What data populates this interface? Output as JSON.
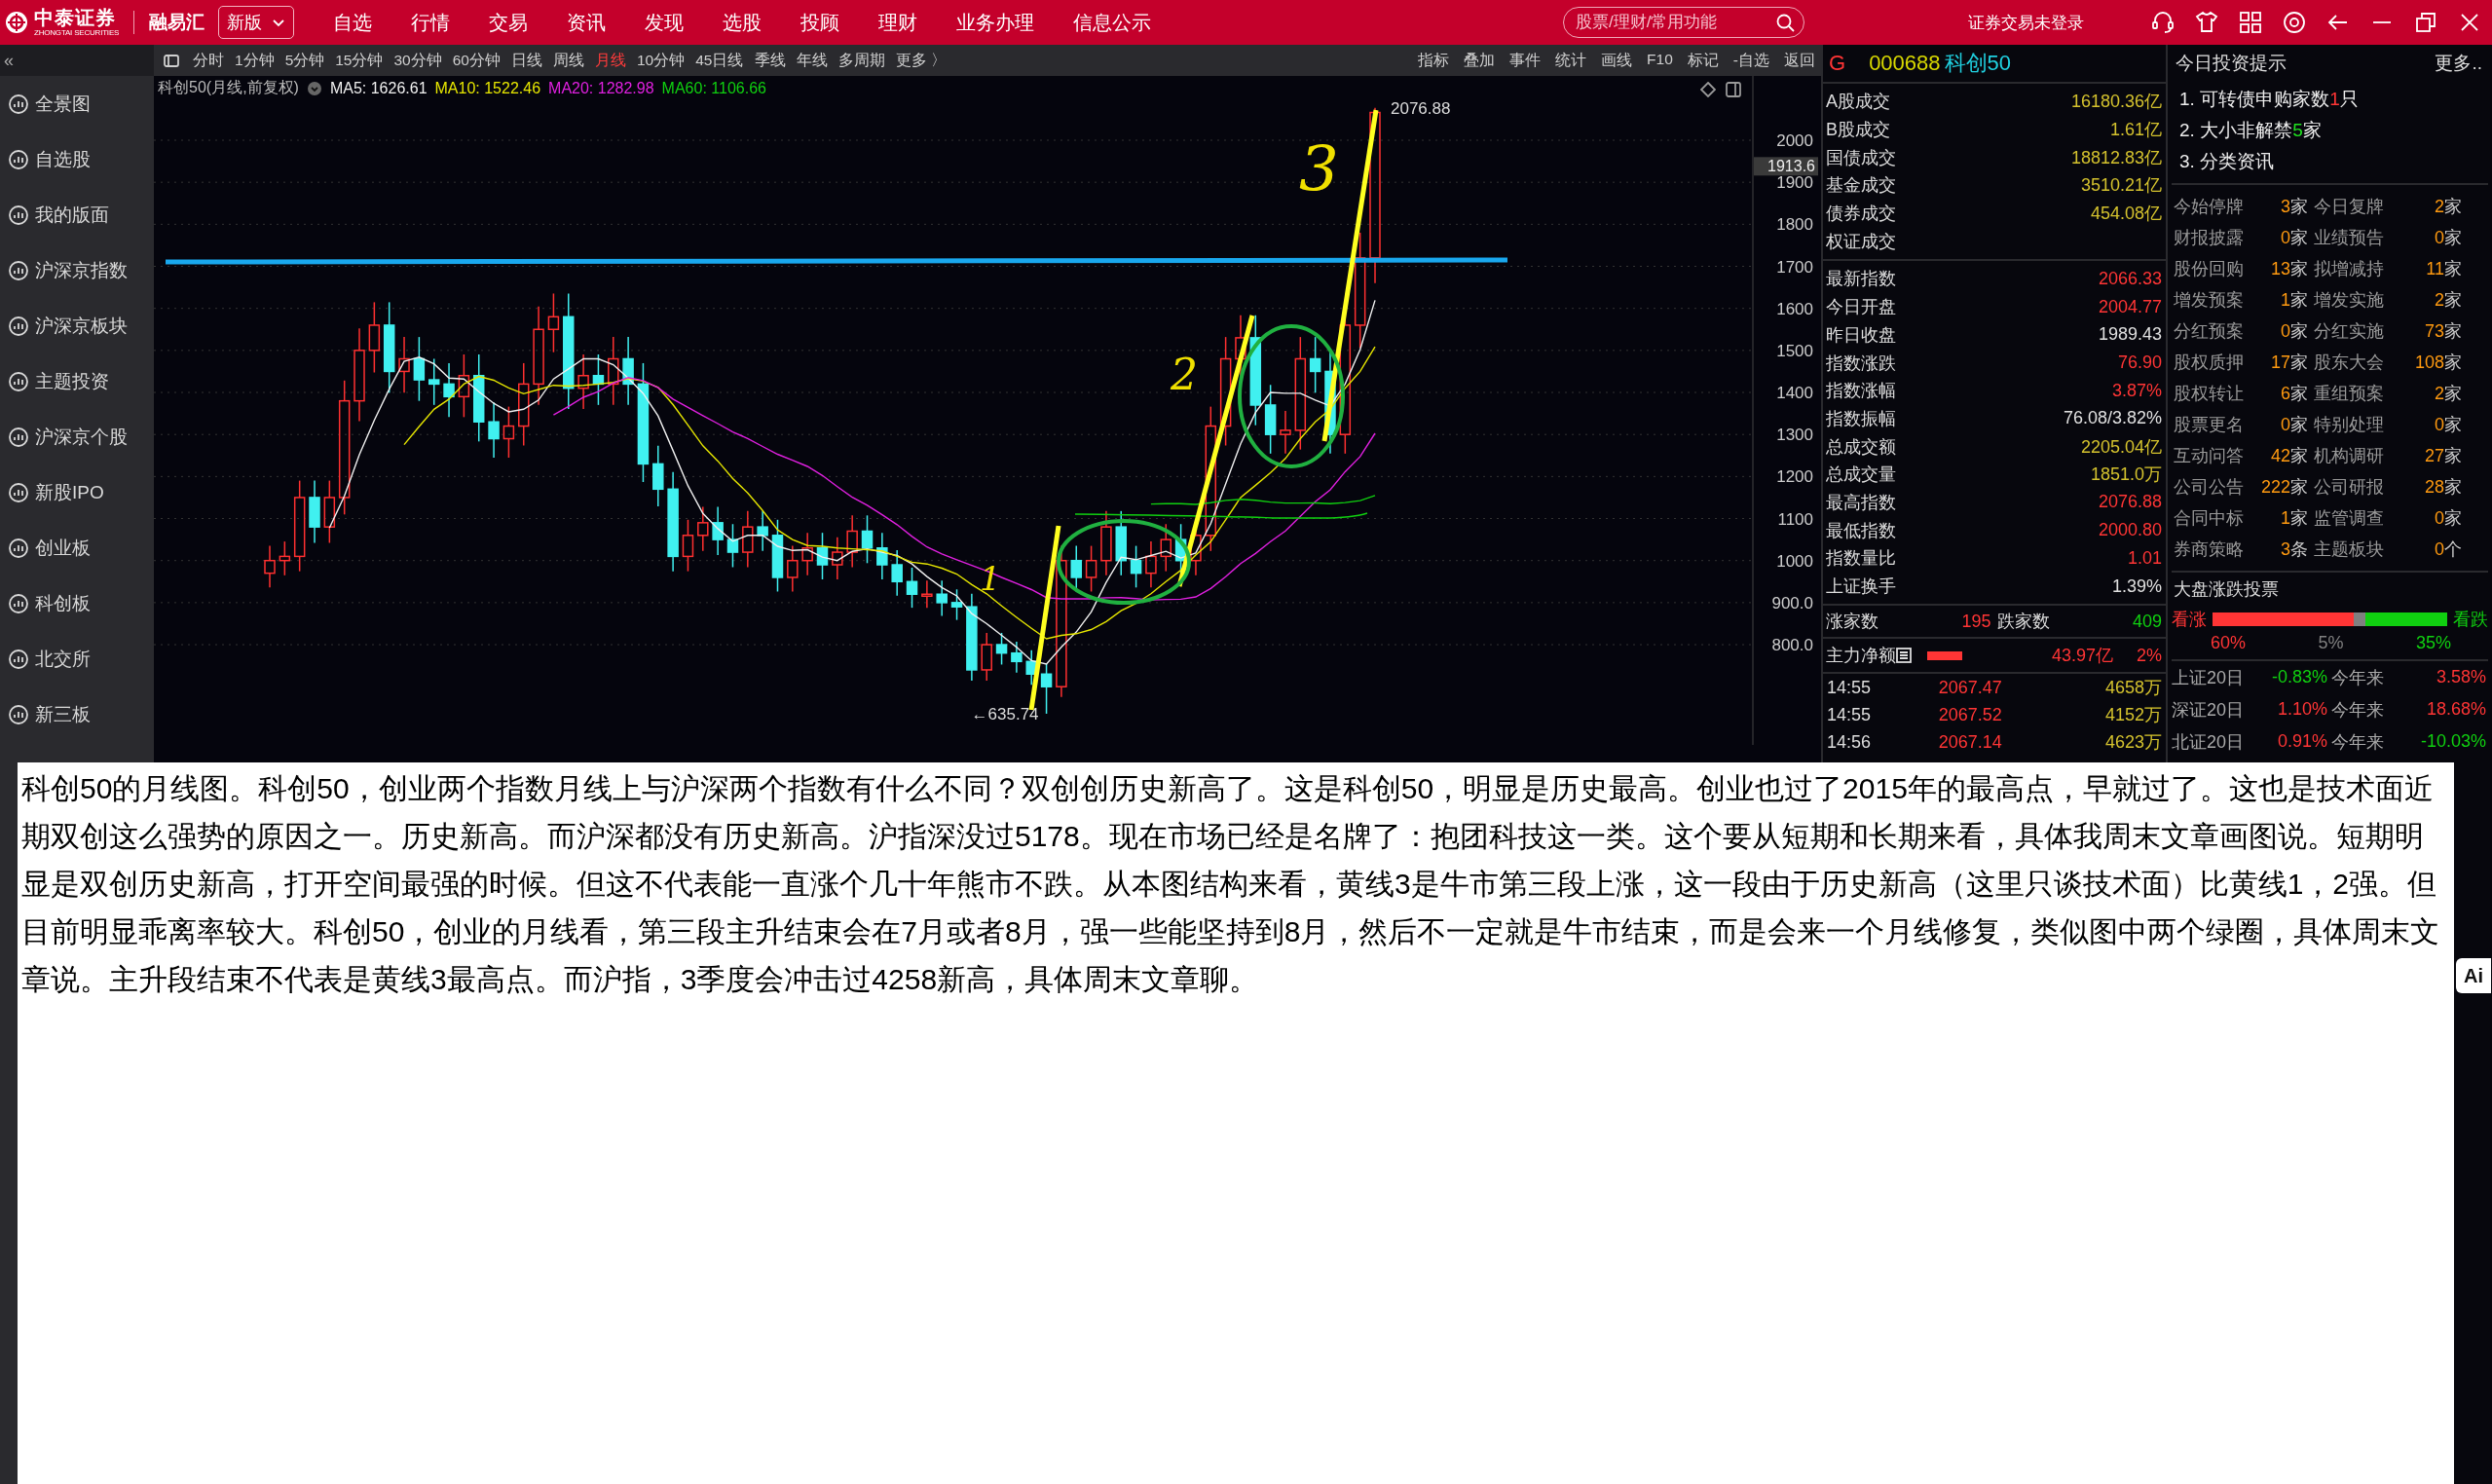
{
  "top_bar": {
    "logo": {
      "name": "中泰证券",
      "subtitle": "ZHONGTAI SECURITIES",
      "brand": "融易汇"
    },
    "version_select": "新版",
    "menu": [
      "自选",
      "行情",
      "交易",
      "资讯",
      "发现",
      "选股",
      "投顾",
      "理财",
      "业务办理",
      "信息公示"
    ],
    "search": {
      "placeholder": "股票/理财/常用功能"
    },
    "login_status": "证券交易未登录"
  },
  "toolbar": {
    "periods": [
      {
        "label": "分时",
        "selected": false
      },
      {
        "label": "1分钟",
        "selected": false
      },
      {
        "label": "5分钟",
        "selected": false
      },
      {
        "label": "15分钟",
        "selected": false
      },
      {
        "label": "30分钟",
        "selected": false
      },
      {
        "label": "60分钟",
        "selected": false
      },
      {
        "label": "日线",
        "selected": false
      },
      {
        "label": "周线",
        "selected": false
      },
      {
        "label": "月线",
        "selected": true
      },
      {
        "label": "10分钟",
        "selected": false
      },
      {
        "label": "45日线",
        "selected": false
      },
      {
        "label": "季线",
        "selected": false
      },
      {
        "label": "年线",
        "selected": false
      },
      {
        "label": "多周期",
        "selected": false
      },
      {
        "label": "更多 〉",
        "selected": false
      }
    ],
    "tools": [
      "指标",
      "叠加",
      "事件",
      "统计",
      "画线",
      "F10",
      "标记",
      "-自选",
      "返回"
    ]
  },
  "sidebar": {
    "collapse": "«",
    "items": [
      "全景图",
      "自选股",
      "我的版面",
      "沪深京指数",
      "沪深京板块",
      "主题投资",
      "沪深京个股",
      "新股IPO",
      "创业板",
      "科创板",
      "北交所",
      "新三板"
    ]
  },
  "chart": {
    "title": "科创50(月线,前复权)",
    "ma": [
      {
        "label": "MA5: 1626.61",
        "color": "#f0f0f0"
      },
      {
        "label": "MA10: 1522.46",
        "color": "#e6e600"
      },
      {
        "label": "MA20: 1282.98",
        "color": "#e020e0"
      },
      {
        "label": "MA60: 1106.66",
        "color": "#10d010"
      }
    ],
    "y_ticks": [
      "2000",
      "1900",
      "1800",
      "1700",
      "1600",
      "1500",
      "1400",
      "1300",
      "1200",
      "1100",
      "1000",
      "900.0",
      "800.0"
    ],
    "cursor_value": "1913.6",
    "high_label": "2076.88",
    "low_label": "←635.74",
    "annotations": [
      "1",
      "2",
      "3"
    ]
  },
  "quote": {
    "flag": "G",
    "code": "000688",
    "name": "科创50",
    "turnover": [
      {
        "label": "A股成交",
        "value": "16180.36亿",
        "color": "#d4c22e"
      },
      {
        "label": "B股成交",
        "value": "1.61亿",
        "color": "#d4c22e"
      },
      {
        "label": "国债成交",
        "value": "18812.83亿",
        "color": "#d4c22e"
      },
      {
        "label": "基金成交",
        "value": "3510.21亿",
        "color": "#d4c22e"
      },
      {
        "label": "债券成交",
        "value": "454.08亿",
        "color": "#d4c22e"
      },
      {
        "label": "权证成交"
      }
    ],
    "stats": [
      {
        "label": "最新指数",
        "value": "2066.33",
        "color": "#ff3535"
      },
      {
        "label": "今日开盘",
        "value": "2004.77",
        "color": "#ff3535"
      },
      {
        "label": "昨日收盘",
        "value": "1989.43",
        "color": "#e0e0e0"
      },
      {
        "label": "指数涨跌",
        "value": "76.90",
        "color": "#ff3535"
      },
      {
        "label": "指数涨幅",
        "value": "3.87%",
        "color": "#ff3535"
      },
      {
        "label": "指数振幅",
        "value": "76.08/3.82%",
        "color": "#e0e0e0"
      },
      {
        "label": "总成交额",
        "value": "2205.04亿",
        "color": "#d4c22e"
      },
      {
        "label": "总成交量",
        "value": "1851.0万",
        "color": "#d4c22e"
      },
      {
        "label": "最高指数",
        "value": "2076.88",
        "color": "#ff3535"
      },
      {
        "label": "最低指数",
        "value": "2000.80",
        "color": "#ff3535"
      },
      {
        "label": "指数量比",
        "value": "1.01",
        "color": "#ff3535"
      },
      {
        "label": "上证换手",
        "value": "1.39%",
        "color": "#e0e0e0"
      }
    ],
    "breadth": {
      "up_label": "涨家数",
      "up": "195",
      "down_label": "跌家数",
      "down": "409"
    },
    "net_flow": {
      "label": "主力净额",
      "value": "43.97亿",
      "percent": "2%"
    },
    "ticks": [
      {
        "time": "14:55",
        "price": "2067.47",
        "volume": "4658万"
      },
      {
        "time": "14:55",
        "price": "2067.52",
        "volume": "4152万"
      },
      {
        "time": "14:56",
        "price": "2067.14",
        "volume": "4623万"
      }
    ]
  },
  "tips": {
    "title": "今日投资提示",
    "more": "更多..",
    "items": [
      {
        "text": "1. 可转债申购家数",
        "count": "1",
        "unit": "只",
        "color": "#ff3535"
      },
      {
        "text": "2. 大小非解禁",
        "count": "5",
        "unit": "家",
        "color": "#20e020"
      },
      {
        "text": "3. 分类资讯"
      }
    ],
    "counts": [
      {
        "label": "今始停牌",
        "count": "3",
        "unit": "家"
      },
      {
        "label": "今日复牌",
        "count": "2",
        "unit": "家"
      },
      {
        "label": "财报披露",
        "count": "0",
        "unit": "家"
      },
      {
        "label": "业绩预告",
        "count": "0",
        "unit": "家"
      },
      {
        "label": "股份回购",
        "count": "13",
        "unit": "家"
      },
      {
        "label": "拟增减持",
        "count": "11",
        "unit": "家"
      },
      {
        "label": "增发预案",
        "count": "1",
        "unit": "家"
      },
      {
        "label": "增发实施",
        "count": "2",
        "unit": "家"
      },
      {
        "label": "分红预案",
        "count": "0",
        "unit": "家"
      },
      {
        "label": "分红实施",
        "count": "73",
        "unit": "家"
      },
      {
        "label": "股权质押",
        "count": "17",
        "unit": "家"
      },
      {
        "label": "股东大会",
        "count": "108",
        "unit": "家"
      },
      {
        "label": "股权转让",
        "count": "6",
        "unit": "家"
      },
      {
        "label": "重组预案",
        "count": "2",
        "unit": "家"
      },
      {
        "label": "股票更名",
        "count": "0",
        "unit": "家"
      },
      {
        "label": "特别处理",
        "count": "0",
        "unit": "家"
      },
      {
        "label": "互动问答",
        "count": "42",
        "unit": "家"
      },
      {
        "label": "机构调研",
        "count": "27",
        "unit": "家"
      },
      {
        "label": "公司公告",
        "count": "222",
        "unit": "家"
      },
      {
        "label": "公司研报",
        "count": "28",
        "unit": "家"
      },
      {
        "label": "合同中标",
        "count": "1",
        "unit": "家"
      },
      {
        "label": "监管调查",
        "count": "0",
        "unit": "家"
      },
      {
        "label": "券商策略",
        "count": "3",
        "unit": "条"
      },
      {
        "label": "主题板块",
        "count": "0",
        "unit": "个"
      }
    ],
    "vote": {
      "title": "大盘涨跌投票",
      "bull_label": "看涨",
      "bear_label": "看跌",
      "level": 0.6,
      "segments": [
        {
          "text": "60%",
          "color": "#ff3535"
        },
        {
          "text": "5%",
          "color": "#808080"
        },
        {
          "text": "35%",
          "color": "#10d010"
        }
      ]
    },
    "returns": [
      {
        "label": "上证20日",
        "value": {
          "text": "-0.83%",
          "color": "#10d010"
        },
        "ytd_label": "今年来",
        "ytd": {
          "text": "3.58%",
          "color": "#ff3535"
        }
      },
      {
        "label": "深证20日",
        "value": {
          "text": "1.10%",
          "color": "#ff3535"
        },
        "ytd_label": "今年来",
        "ytd": {
          "text": "18.68%",
          "color": "#ff3535"
        }
      },
      {
        "label": "北证20日",
        "value": {
          "text": "0.91%",
          "color": "#ff3535"
        },
        "ytd_label": "今年来",
        "ytd": {
          "text": "-10.03%",
          "color": "#10d010"
        }
      }
    ]
  },
  "note": {
    "text": "科创50的月线图。科创50，创业两个指数月线上与沪深两个指数有什么不同？双创创历史新高了。这是科创50，明显是历史最高。创业也过了2015年的最高点，早就过了。这也是技术面近期双创这么强势的原因之一。历史新高。而沪深都没有历史新高。沪指深没过5178。现在市场已经是名牌了：抱团科技这一类。这个要从短期和长期来看，具体我周末文章画图说。短期明显是双创历史新高，打开空间最强的时候。但这不代表能一直涨个几十年熊市不跌。从本图结构来看，黄线3是牛市第三段上涨，这一段由于历史新高（这里只谈技术面）比黄线1，2强。但目前明显乖离率较大。科创50，创业的月线看，第三段主升结束会在7月或者8月，强一些能坚持到8月，然后不一定就是牛市结束，而是会来一个月线修复，类似图中两个绿圈，具体周末文章说。主升段结束不代表是黄线3最高点。而沪指，3季度会冲击过4258新高，具体周末文章聊。"
  },
  "ai_button": "Ai"
}
